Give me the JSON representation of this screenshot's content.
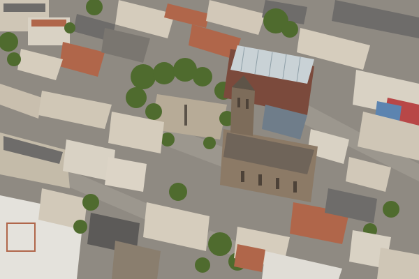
{
  "scene": {
    "kind": "aerial photograph",
    "colors": {
      "asphalt": "#8f8a82",
      "roof_grey": "#6e6c6a",
      "roof_red": "#b0664a",
      "roof_dark": "#4a4a4c",
      "facade_light": "#d9d2c4",
      "tree_green": "#4f6b2e",
      "church_stone": "#8c7a66",
      "square_paving": "#b7ab97"
    }
  }
}
